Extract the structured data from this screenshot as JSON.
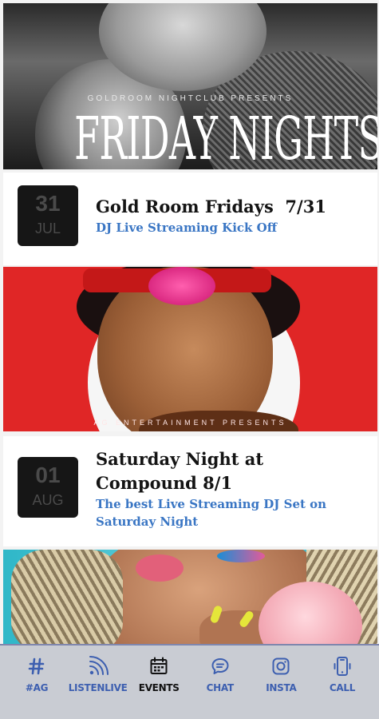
{
  "banner1": {
    "kicker": "GOLDROOM NIGHTCLUB PRESENTS",
    "title": "FRIDAY NIGHTS"
  },
  "events": [
    {
      "day": "31",
      "month": "JUL",
      "title": "Gold Room Fridays  7/31",
      "subtitle": "DJ Live Streaming Kick Off"
    },
    {
      "day": "01",
      "month": "AUG",
      "title": "Saturday Night at Compound 8/1",
      "subtitle": "The best Live Streaming DJ Set on Saturday Night"
    }
  ],
  "banner2": {
    "kicker": "AG ENTERTAINMENT PRESENTS"
  },
  "tabbar": {
    "items": [
      {
        "label": "#AG",
        "icon": "hashtag-icon"
      },
      {
        "label": "LISTENLIVE",
        "icon": "broadcast-icon"
      },
      {
        "label": "EVENTS",
        "icon": "calendar-icon"
      },
      {
        "label": "CHAT",
        "icon": "chat-bubble-icon"
      },
      {
        "label": "INSTA",
        "icon": "instagram-icon"
      },
      {
        "label": "CALL",
        "icon": "phone-icon"
      }
    ],
    "active_label": "EVENTS"
  },
  "colors": {
    "accent": "#3a76c4",
    "tab_inactive": "#3d5fb0",
    "tab_active": "#111111",
    "tabbar_bg": "#c9ccd3",
    "date_box": "#161616",
    "banner_red": "#e02626",
    "banner_teal": "#2fb7c8"
  }
}
